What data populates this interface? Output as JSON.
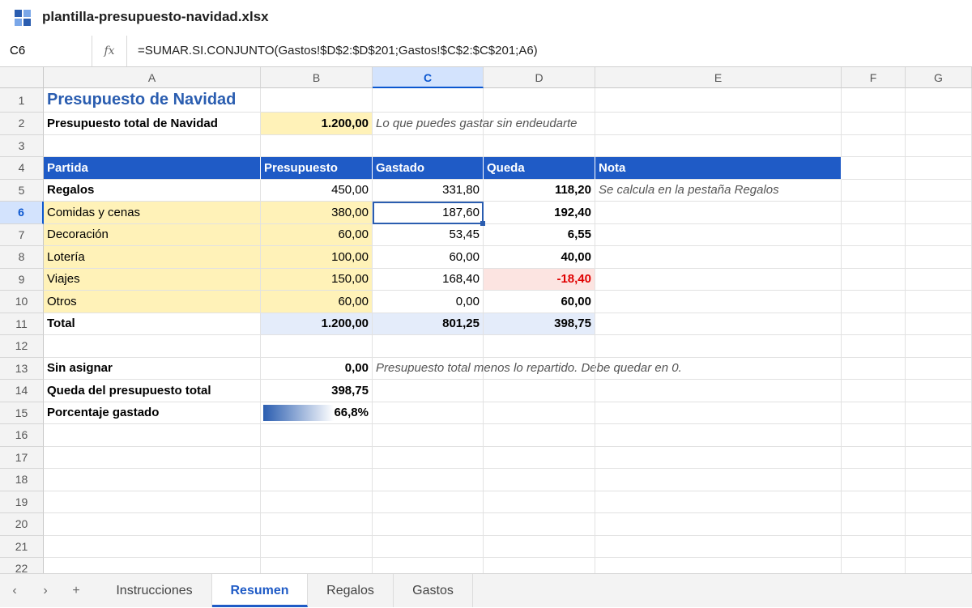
{
  "window": {
    "title": "plantilla-presupuesto-navidad.xlsx"
  },
  "formula_bar": {
    "cell_ref": "C6",
    "fx_label": "fx",
    "formula": "=SUMAR.SI.CONJUNTO(Gastos!$D$2:$D$201;Gastos!$C$2:$C$201;A6)"
  },
  "columns": [
    "A",
    "B",
    "C",
    "D",
    "E",
    "F",
    "G"
  ],
  "rows": [
    "1",
    "2",
    "3",
    "4",
    "5",
    "6",
    "7",
    "8",
    "9",
    "10",
    "11",
    "12",
    "13",
    "14",
    "15",
    "16",
    "17",
    "18",
    "19",
    "20",
    "21",
    "22"
  ],
  "cells": {
    "A1": "Presupuesto de Navidad",
    "A2": "Presupuesto total de Navidad",
    "B2": "1.200,00",
    "C2": "Lo que puedes gastar sin endeudarte",
    "A4": "Partida",
    "B4": "Presupuesto",
    "C4": "Gastado",
    "D4": "Queda",
    "E4": "Nota",
    "A5": "Regalos",
    "B5": "450,00",
    "C5": "331,80",
    "D5": "118,20",
    "E5": "Se calcula en la pestaña Regalos",
    "A6": "Comidas y cenas",
    "B6": "380,00",
    "C6": "187,60",
    "D6": "192,40",
    "A7": "Decoración",
    "B7": "60,00",
    "C7": "53,45",
    "D7": "6,55",
    "A8": "Lotería",
    "B8": "100,00",
    "C8": "60,00",
    "D8": "40,00",
    "A9": "Viajes",
    "B9": "150,00",
    "C9": "168,40",
    "D9": "-18,40",
    "A10": "Otros",
    "B10": "60,00",
    "C10": "0,00",
    "D10": "60,00",
    "A11": "Total",
    "B11": "1.200,00",
    "C11": "801,25",
    "D11": "398,75",
    "A13": "Sin asignar",
    "B13": "0,00",
    "C13": "Presupuesto total menos lo repartido. Debe quedar en 0.",
    "A14": "Queda del presupuesto total",
    "B14": "398,75",
    "A15": "Porcentaje gastado",
    "B15": "66,8%"
  },
  "percent_spent": 0.668,
  "sheet_tabs": [
    {
      "label": "Instrucciones",
      "active": false
    },
    {
      "label": "Resumen",
      "active": true
    },
    {
      "label": "Regalos",
      "active": false
    },
    {
      "label": "Gastos",
      "active": false
    }
  ],
  "nav": {
    "prev": "‹",
    "next": "›",
    "add": "+"
  },
  "colors": {
    "accent": "#1f5bc6",
    "input_fill": "#fff2b8",
    "negative": "#e00000",
    "total_fill": "#e4ecfa"
  }
}
